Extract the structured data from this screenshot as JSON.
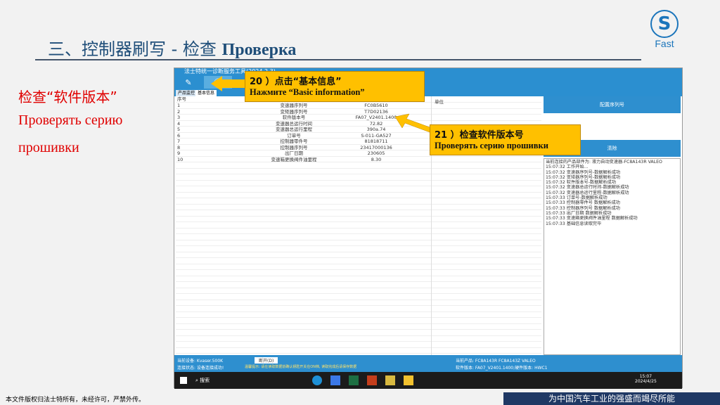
{
  "slide": {
    "title_cn": "三、控制器刷写 - 检查",
    "title_ru": "Проверка",
    "logo_text": "Fast",
    "left_cn": "检查“软件版本”",
    "left_ru1": "Проверять серию",
    "left_ru2": "прошивки",
    "footer_left": "本文件版权归法士特所有，未经许可，严禁外传。",
    "footer_right": "为中国汽车工业的强盛而竭尽所能"
  },
  "callouts": {
    "c20_cn": "20 ）点击“基本信息”",
    "c20_ru": "Нажмите “Basic information”",
    "c21_cn": "21 ）检查软件版本号",
    "c21_ru": "Проверять серию прошивки"
  },
  "app": {
    "window_title": "法士特统一诊断服务工具(2024.2.3)",
    "tabs": [
      "产品监控",
      "基本信息"
    ],
    "headers": {
      "index": "序号",
      "unit": "单位"
    },
    "rows": [
      {
        "i": "1",
        "name": "变速器序列号",
        "value": "FC0B5610"
      },
      {
        "i": "2",
        "name": "变矩器序列号",
        "value": "T7D02136"
      },
      {
        "i": "3",
        "name": "软件版本号",
        "value": "FA07_V2401.1400"
      },
      {
        "i": "4",
        "name": "变速器总运行时间",
        "value": "72.82"
      },
      {
        "i": "5",
        "name": "变速器总运行里程",
        "value": "390a.74"
      },
      {
        "i": "6",
        "name": "订单号",
        "value": "S-011-GA527"
      },
      {
        "i": "7",
        "name": "控制器零件号",
        "value": "81818711"
      },
      {
        "i": "8",
        "name": "控制器序列号",
        "value": "23417000136"
      },
      {
        "i": "9",
        "name": "出厂日期",
        "value": "230605"
      },
      {
        "i": "10",
        "name": "变速箱更换阀件油里程",
        "value": "8.30"
      }
    ],
    "btn_config": "配置序列号",
    "btn_clear": "清除",
    "log": [
      "当前连接的产品部件为: 液力自动变速器-FC8A143R VALEO",
      "15:07:32 工作开始...",
      "15:07:32 变速器序列号-数据解析成功",
      "15:07:32 变矩器序列号-数据解析成功",
      "15:07:32 软件版本号-数据解析成功",
      "15:07:32 变速器总运行时间-数据解析成功",
      "15:07:32 变速器总运行里程-数据解析成功",
      "15:07:33 订单号-数据解析成功",
      "15:07:33 控制器零件号 数据解析成功",
      "15:07:33 控制器序列号 数据解析成功",
      "15:07:33 出厂日期 数据解析成功",
      "15:07:33 变速箱更换阀件油里程 数据解析成功",
      "15:07:33 基础信息读取完毕"
    ],
    "status": {
      "device": "当前设备: Kvaser.500K",
      "conn": "连接状态: 设备连接成功!",
      "open_btn": "断开(D)",
      "hint": "温馨提示: 请在读取数据前确认钥匙开关在ON档, 读取完成后请保存数据",
      "product": "当前产品: FC8A143R FC8A143Z VALEO",
      "version": "软件版本: FA07_V2401.1400;硬件版本: HWC1"
    },
    "taskbar": {
      "search": "搜索",
      "time": "15:07",
      "date": "2024/4/25"
    }
  }
}
